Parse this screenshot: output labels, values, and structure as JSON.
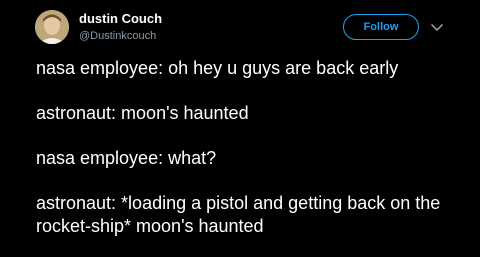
{
  "author": {
    "display_name": "dustin Couch",
    "handle": "@Dustinkcouch",
    "avatar_icon": "user-avatar"
  },
  "actions": {
    "follow_label": "Follow",
    "menu_icon": "chevron-down-icon"
  },
  "tweet": {
    "lines": [
      "nasa employee: oh hey u guys are back early",
      "astronaut: moon's haunted",
      "nasa employee: what?",
      "astronaut: *loading a pistol and getting back on the rocket-ship* moon's haunted"
    ]
  },
  "colors": {
    "background": "#000000",
    "text": "#ffffff",
    "muted": "#8899a6",
    "accent": "#1da1f2"
  }
}
